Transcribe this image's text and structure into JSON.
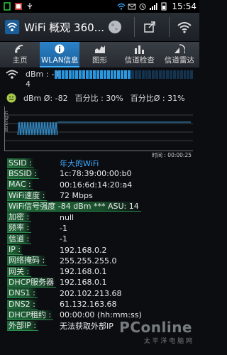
{
  "status_bar": {
    "time": "15:54",
    "left_icons": [
      "sim-icon",
      "square-notif-icon",
      "usb-icon"
    ],
    "right_icons": [
      "wifi-status-icon",
      "mail-icon",
      "alarm-icon",
      "signal-icon",
      "battery-icon"
    ]
  },
  "action_bar": {
    "title": "WiFi 概观 360...",
    "actions": [
      "moon-icon",
      "share-icon",
      "wifi-icon"
    ]
  },
  "tabs": [
    {
      "label": "主页",
      "icon": "wifi-tab-icon",
      "active": false
    },
    {
      "label": "WLAN信息",
      "icon": "info-icon",
      "active": true
    },
    {
      "label": "图形",
      "icon": "graph-icon",
      "active": false
    },
    {
      "label": "信道检查",
      "icon": "bar-chart-icon",
      "active": false
    },
    {
      "label": "信道雷达",
      "icon": "radar-icon",
      "active": false
    }
  ],
  "signal": {
    "dbm_label": "dBm :",
    "dbm_value": "-8",
    "dbm_sub": "4",
    "meter_total": 40,
    "meter_on": 22,
    "avg_text": "dBm Ø: -82",
    "pct_text": "百分比 :  30%",
    "pct_avg_text": "百分比Ø :  31%"
  },
  "graph": {
    "ylabel": "strength",
    "time_label": "时间 : 00:00:25",
    "colors": {
      "line": "#3a9ad9",
      "grid": "#444"
    }
  },
  "info": [
    {
      "key": "SSID :",
      "value": "年大的WiFi",
      "accent": true
    },
    {
      "key": "BSSID :",
      "value": "1c:78:39:00:00:b0"
    },
    {
      "key": "MAC :",
      "value": "00:16:6d:14:20:a4"
    },
    {
      "key": "WiFi速度 :",
      "value": "72 Mbps"
    },
    {
      "key": "WiFi信号强度 -84 dBm *** ASU: 14",
      "value": "",
      "wide": true
    },
    {
      "key": "加密 :",
      "value": "null"
    },
    {
      "key": "频率 :",
      "value": "-1"
    },
    {
      "key": "信道 :",
      "value": "-1"
    },
    {
      "key": "IP :",
      "value": "192.168.0.2"
    },
    {
      "key": "网络掩码 :",
      "value": "255.255.255.0"
    },
    {
      "key": "网关 :",
      "value": "192.168.0.1"
    },
    {
      "key": "DHCP服务器",
      "value": "192.168.0.1"
    },
    {
      "key": "DNS1 :",
      "value": "202.102.213.68"
    },
    {
      "key": "DNS2 :",
      "value": "61.132.163.68"
    },
    {
      "key": "DHCP租约 :",
      "value": "00:00:00 (hh:mm:ss)"
    },
    {
      "key": "外部IP :",
      "value": "无法获取外部IP"
    }
  ],
  "watermark": {
    "logo": "PConline",
    "sub": "太 平 洋 电 脑 网"
  },
  "accent_color": "#2b83c9"
}
